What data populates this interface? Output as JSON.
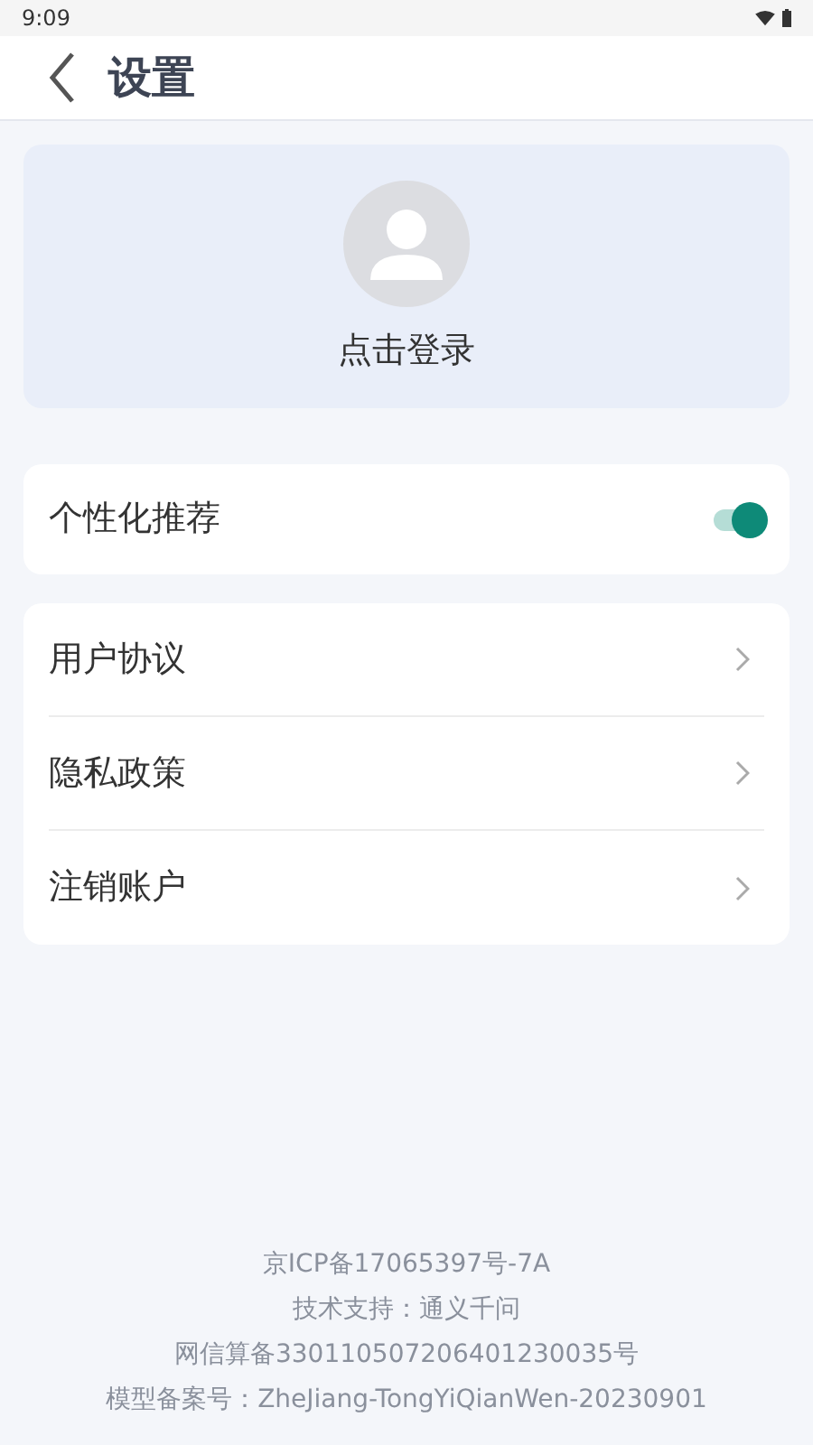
{
  "status_bar": {
    "time": "9:09"
  },
  "header": {
    "title": "设置"
  },
  "profile": {
    "login_label": "点击登录"
  },
  "recommend": {
    "label": "个性化推荐",
    "on": true
  },
  "menu": [
    {
      "label": "用户协议"
    },
    {
      "label": "隐私政策"
    },
    {
      "label": "注销账户"
    }
  ],
  "footer": [
    "京ICP备17065397号-7A",
    "技术支持：通义千问",
    "网信算备330110507206401230035号",
    "模型备案号：ZheJiang-TongYiQianWen-20230901"
  ]
}
